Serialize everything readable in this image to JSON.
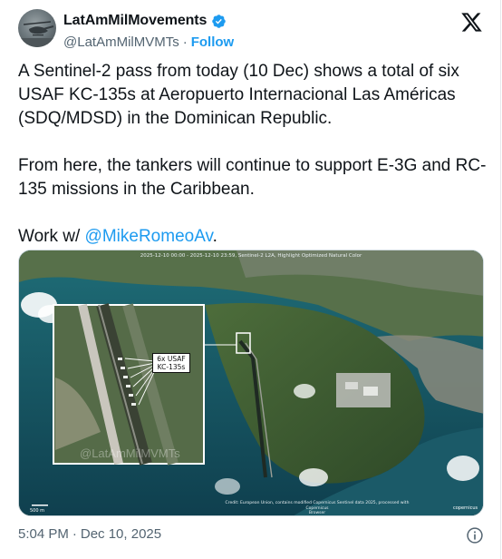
{
  "author": {
    "display_name": "LatAmMilMovements",
    "handle": "@LatAmMilMVMTs",
    "separator": "·",
    "follow_label": "Follow",
    "verified_color": "#1d9bf0"
  },
  "tweet": {
    "paragraph1": "A Sentinel-2 pass from today (10 Dec) shows a total of six USAF KC-135s at Aeropuerto Internacional Las Américas (SDQ/MDSD) in the Dominican Republic.",
    "paragraph2": "From here, the tankers will continue to support E-3G and RC-135 missions in the Caribbean.",
    "paragraph3_prefix": "Work w/ ",
    "paragraph3_mention": "@MikeRomeoAv",
    "paragraph3_suffix": "."
  },
  "media": {
    "caption_top": "2025-12-10 00:00 - 2025-12-10 23:59, Sentinel-2 L2A, Highlight Optimized Natural Color",
    "callout_line1": "6x USAF",
    "callout_line2": "KC-135s",
    "watermark": "@LatAmMilMVMTs",
    "credit_line1": "Credit: European Union, contains modified Copernicus Sentinel data 2025, processed with Copernicus",
    "credit_line2": "Browser",
    "scale_label": "500 m",
    "copernicus_label": "copernicus"
  },
  "footer": {
    "time": "5:04 PM",
    "separator": "·",
    "date": "Dec 10, 2025"
  },
  "icons": {
    "verified": "verified-badge-icon",
    "x_logo": "x-logo-icon",
    "info": "info-icon"
  },
  "colors": {
    "link": "#1d9bf0",
    "text": "#0f1419",
    "muted": "#536471"
  }
}
